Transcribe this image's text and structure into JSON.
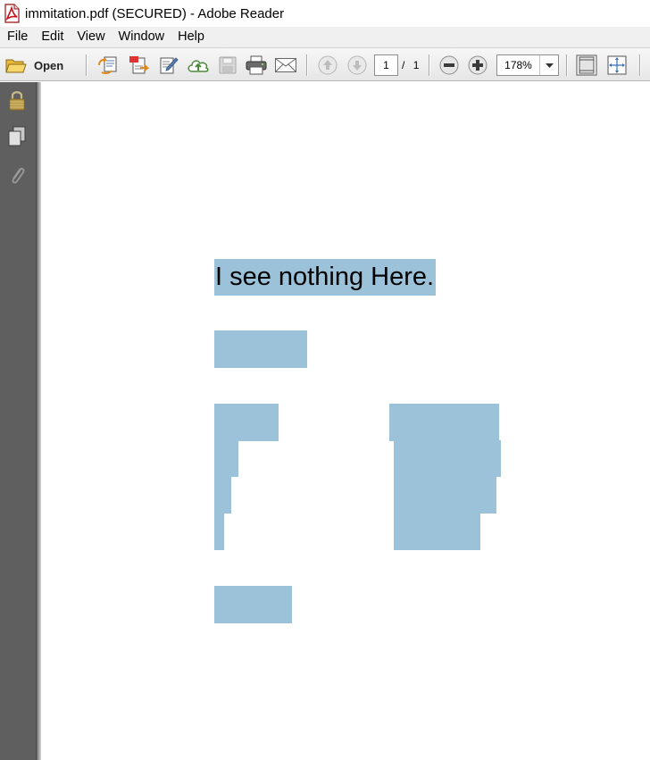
{
  "window": {
    "title": "immitation.pdf (SECURED) - Adobe Reader"
  },
  "menu": [
    "File",
    "Edit",
    "View",
    "Window",
    "Help"
  ],
  "toolbar": {
    "open_label": "Open",
    "page_current": "1",
    "page_separator": "/",
    "page_total": "1",
    "zoom": "178%"
  },
  "document": {
    "heading": "I see nothing Here.",
    "highlight_color": "#9cc2da"
  },
  "colors": {
    "nav_pane": "#5f5f5f",
    "pdf_icon_red": "#c4161c"
  }
}
